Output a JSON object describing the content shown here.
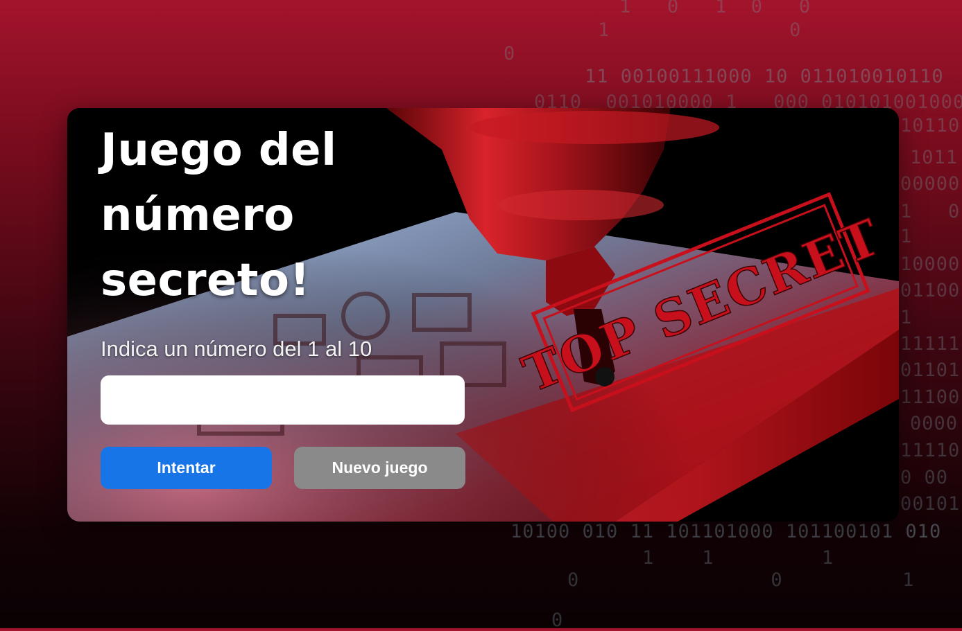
{
  "background": {
    "binary_lines": [
      "1   0   1  0   0",
      "1               0",
      "0",
      "11 00100111000 10 011010010110",
      "0110  001010000 1   000 010101001000",
      "10110",
      "1011",
      "00000",
      "1   0",
      "1     0",
      "10000",
      "01100",
      "1",
      "11111",
      "01101",
      "11100",
      "0000",
      "11110",
      "0 00",
      "00101",
      "10100 010 11 101101000 101100101 010",
      "1    1         1",
      "0                0          1",
      "0"
    ]
  },
  "game": {
    "title": "Juego del número secreto!",
    "prompt": "Indica un número del 1 al 10",
    "input": {
      "value": "",
      "placeholder": ""
    },
    "buttons": {
      "try": "Intentar",
      "new_game": "Nuevo juego"
    },
    "stamp_text": "TOP SECRET"
  },
  "colors": {
    "primary_button": "#1875e8",
    "secondary_button": "#8a8a8a",
    "stamp_red": "#c8101c"
  }
}
